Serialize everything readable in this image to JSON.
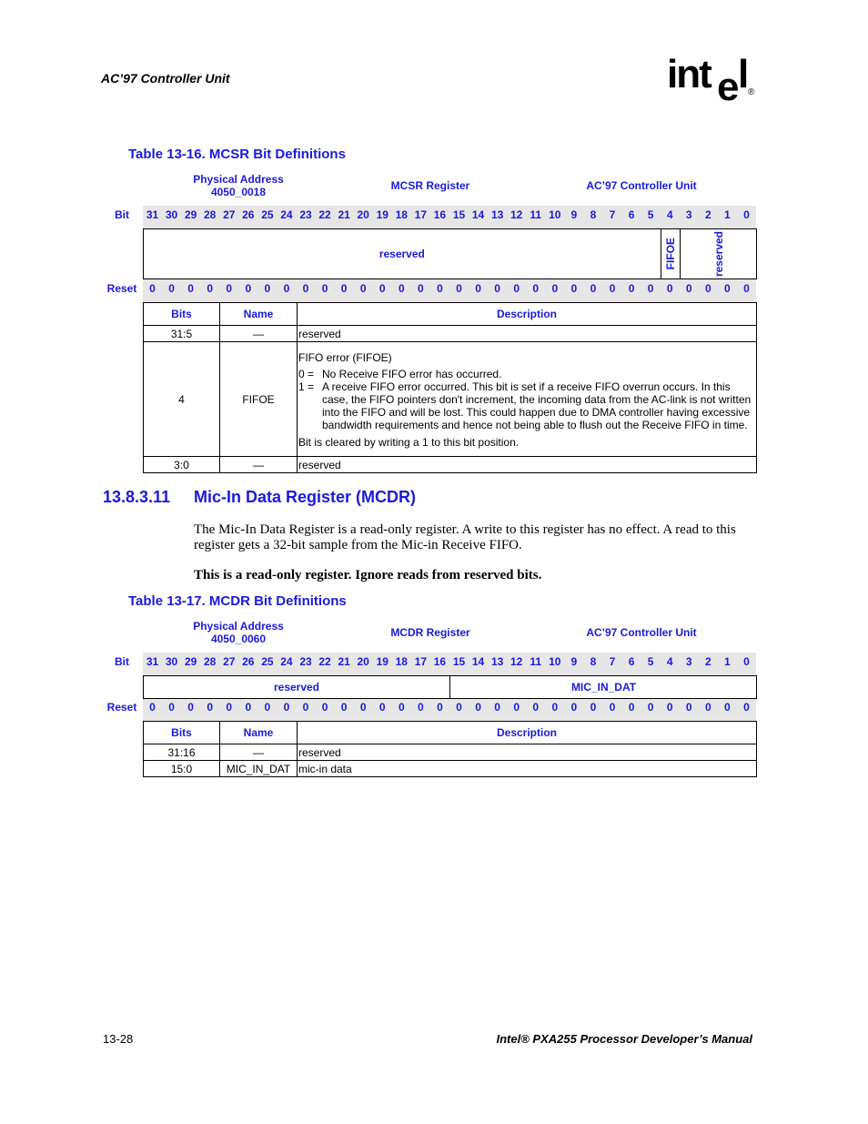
{
  "header": {
    "running_title": "AC’97 Controller Unit",
    "logo": {
      "text": "int",
      "e": "e",
      "l": "l",
      "reg": "®"
    }
  },
  "table1": {
    "title": "Table 13-16. MCSR Bit Definitions",
    "phys_addr_label": "Physical Address",
    "phys_addr": "4050_0018",
    "register": "MCSR Register",
    "unit": "AC’97 Controller Unit",
    "bit_label": "Bit",
    "reset_label": "Reset",
    "bits": [
      "31",
      "30",
      "29",
      "28",
      "27",
      "26",
      "25",
      "24",
      "23",
      "22",
      "21",
      "20",
      "19",
      "18",
      "17",
      "16",
      "15",
      "14",
      "13",
      "12",
      "11",
      "10",
      "9",
      "8",
      "7",
      "6",
      "5",
      "4",
      "3",
      "2",
      "1",
      "0"
    ],
    "resets": [
      "0",
      "0",
      "0",
      "0",
      "0",
      "0",
      "0",
      "0",
      "0",
      "0",
      "0",
      "0",
      "0",
      "0",
      "0",
      "0",
      "0",
      "0",
      "0",
      "0",
      "0",
      "0",
      "0",
      "0",
      "0",
      "0",
      "0",
      "0",
      "0",
      "0",
      "0",
      "0"
    ],
    "fields": [
      {
        "name": "reserved",
        "msb": 31,
        "lsb": 5,
        "vertical": false
      },
      {
        "name": "FIFOE",
        "msb": 4,
        "lsb": 4,
        "vertical": true
      },
      {
        "name": "reserved",
        "msb": 3,
        "lsb": 0,
        "vertical": true
      }
    ],
    "columns": {
      "bits": "Bits",
      "name": "Name",
      "description": "Description"
    },
    "rows": [
      {
        "bits": "31:5",
        "name": "—",
        "description": "reserved"
      },
      {
        "bits": "4",
        "name": "FIFOE",
        "desc_title": "FIFO error (FIFOE)",
        "items": [
          {
            "k": "0 =",
            "v": "No Receive FIFO error has occurred."
          },
          {
            "k": "1 =",
            "v": "A receive FIFO error occurred. This bit is set if a receive FIFO overrun occurs. In this case, the FIFO pointers don't increment, the incoming data from the AC-link is not written into the FIFO and will be lost. This could happen due to DMA controller having excessive bandwidth requirements and hence not being able to flush out the Receive FIFO in time."
          }
        ],
        "desc_note": "Bit is cleared by writing a 1 to this bit position."
      },
      {
        "bits": "3:0",
        "name": "—",
        "description": "reserved"
      }
    ]
  },
  "section": {
    "number": "13.8.3.11",
    "title": "Mic-In Data Register (MCDR)",
    "paragraph": "The Mic-In Data Register is a read-only register. A write to this register has no effect. A read to this register gets a 32-bit sample from the Mic-in Receive FIFO.",
    "note": "This is a read-only register. Ignore reads from reserved bits."
  },
  "table2": {
    "title": "Table 13-17. MCDR Bit Definitions",
    "phys_addr_label": "Physical Address",
    "phys_addr": "4050_0060",
    "register": "MCDR Register",
    "unit": "AC’97 Controller Unit",
    "bit_label": "Bit",
    "reset_label": "Reset",
    "bits": [
      "31",
      "30",
      "29",
      "28",
      "27",
      "26",
      "25",
      "24",
      "23",
      "22",
      "21",
      "20",
      "19",
      "18",
      "17",
      "16",
      "15",
      "14",
      "13",
      "12",
      "11",
      "10",
      "9",
      "8",
      "7",
      "6",
      "5",
      "4",
      "3",
      "2",
      "1",
      "0"
    ],
    "resets": [
      "0",
      "0",
      "0",
      "0",
      "0",
      "0",
      "0",
      "0",
      "0",
      "0",
      "0",
      "0",
      "0",
      "0",
      "0",
      "0",
      "0",
      "0",
      "0",
      "0",
      "0",
      "0",
      "0",
      "0",
      "0",
      "0",
      "0",
      "0",
      "0",
      "0",
      "0",
      "0"
    ],
    "fields": [
      {
        "name": "reserved",
        "msb": 31,
        "lsb": 16,
        "vertical": false
      },
      {
        "name": "MIC_IN_DAT",
        "msb": 15,
        "lsb": 0,
        "vertical": false
      }
    ],
    "columns": {
      "bits": "Bits",
      "name": "Name",
      "description": "Description"
    },
    "rows": [
      {
        "bits": "31:16",
        "name": "—",
        "description": "reserved"
      },
      {
        "bits": "15:0",
        "name": "MIC_IN_DAT",
        "description": "mic-in data"
      }
    ]
  },
  "footer": {
    "page_number": "13-28",
    "manual_title": "Intel® PXA255 Processor Developer’s Manual"
  }
}
